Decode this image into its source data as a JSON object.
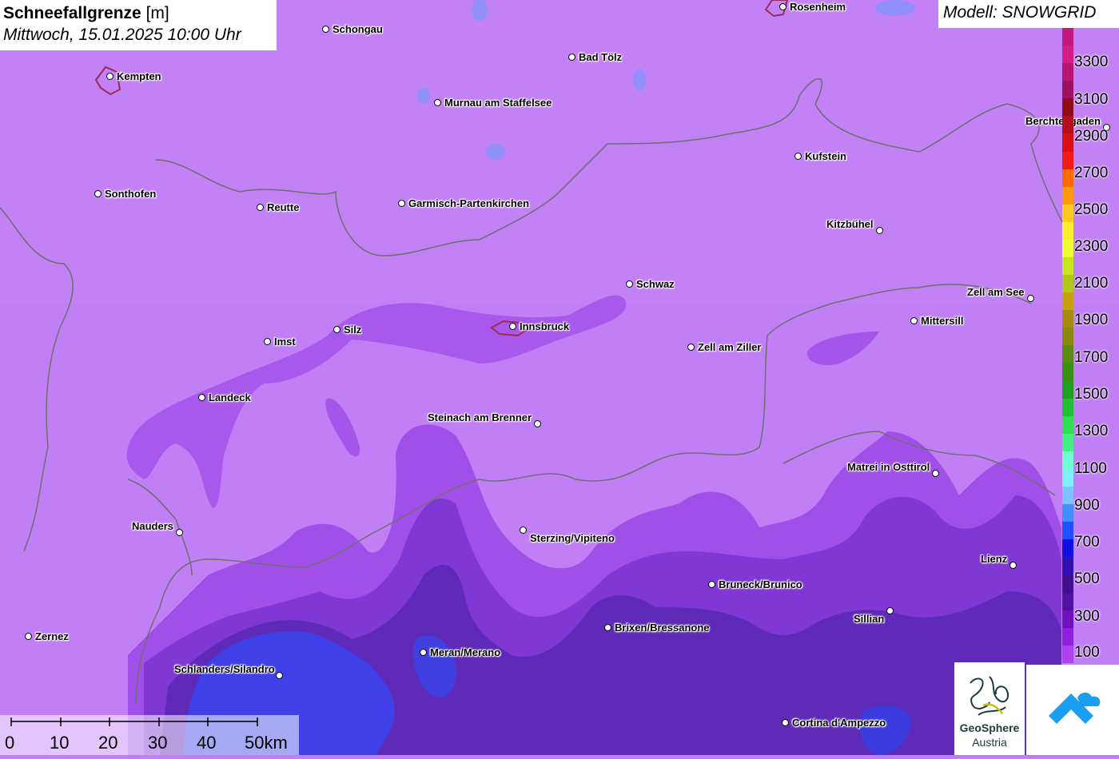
{
  "title": {
    "main": "Schneefallgrenze",
    "unit": "[m]",
    "datetime": "Mittwoch, 15.01.2025 10:00 Uhr"
  },
  "model_label": "Modell: SNOWGRID",
  "colors": {
    "base_fill": "#c07ff5",
    "mid_fill": "#9a4ce8",
    "deep_fill": "#6a2bc0",
    "blue_fill": "#3a3ce0",
    "border_line": "#6e6e6e"
  },
  "cities": [
    {
      "name": "Rosenheim"
    },
    {
      "name": "Schongau"
    },
    {
      "name": "Kempten"
    },
    {
      "name": "Bad Tölz"
    },
    {
      "name": "Murnau am Staffelsee"
    },
    {
      "name": "Berchtesgaden"
    },
    {
      "name": "Kufstein"
    },
    {
      "name": "Sonthofen"
    },
    {
      "name": "Reutte"
    },
    {
      "name": "Garmisch-Partenkirchen"
    },
    {
      "name": "Kitzbühel"
    },
    {
      "name": "Schwaz"
    },
    {
      "name": "Zell am See"
    },
    {
      "name": "Mittersill"
    },
    {
      "name": "Silz"
    },
    {
      "name": "Innsbruck"
    },
    {
      "name": "Imst"
    },
    {
      "name": "Zell am Ziller"
    },
    {
      "name": "Landeck"
    },
    {
      "name": "Steinach am Brenner"
    },
    {
      "name": "Matrei in Osttirol"
    },
    {
      "name": "Nauders"
    },
    {
      "name": "Sterzing/Vipiteno"
    },
    {
      "name": "Lienz"
    },
    {
      "name": "Bruneck/Brunico"
    },
    {
      "name": "Sillian"
    },
    {
      "name": "Brixen/Bressanone"
    },
    {
      "name": "Zernez"
    },
    {
      "name": "Meran/Merano"
    },
    {
      "name": "Schlanders/Silandro"
    },
    {
      "name": "Cortina d'Ampezzo"
    }
  ],
  "legend": {
    "labels": [
      "3300",
      "3100",
      "2900",
      "2700",
      "2500",
      "2300",
      "2100",
      "1900",
      "1700",
      "1500",
      "1300",
      "1100",
      "900",
      "700",
      "500",
      "300",
      "100"
    ],
    "colors": [
      "#c3177a",
      "#d21e82",
      "#b81572",
      "#9e1060",
      "#8f0c18",
      "#b50d1a",
      "#d80f14",
      "#f21a14",
      "#ff6a00",
      "#ff9a10",
      "#ffc820",
      "#ffee30",
      "#f0ff30",
      "#c8e620",
      "#b0c818",
      "#c8a010",
      "#a88a10",
      "#8a8a10",
      "#5a8a10",
      "#3a9010",
      "#20a020",
      "#20c030",
      "#30e050",
      "#40f080",
      "#70ffd0",
      "#80f0ff",
      "#80c0ff",
      "#4090ff",
      "#2050ff",
      "#1010e0",
      "#3010b0",
      "#40108f",
      "#5010a0",
      "#7010c0",
      "#9020e0",
      "#b040f0"
    ]
  },
  "scale": {
    "labels": [
      "0",
      "10",
      "20",
      "30",
      "40",
      "50km"
    ]
  },
  "logos": {
    "geosphere_name": "GeoSphere",
    "geosphere_sub": "Austria"
  }
}
